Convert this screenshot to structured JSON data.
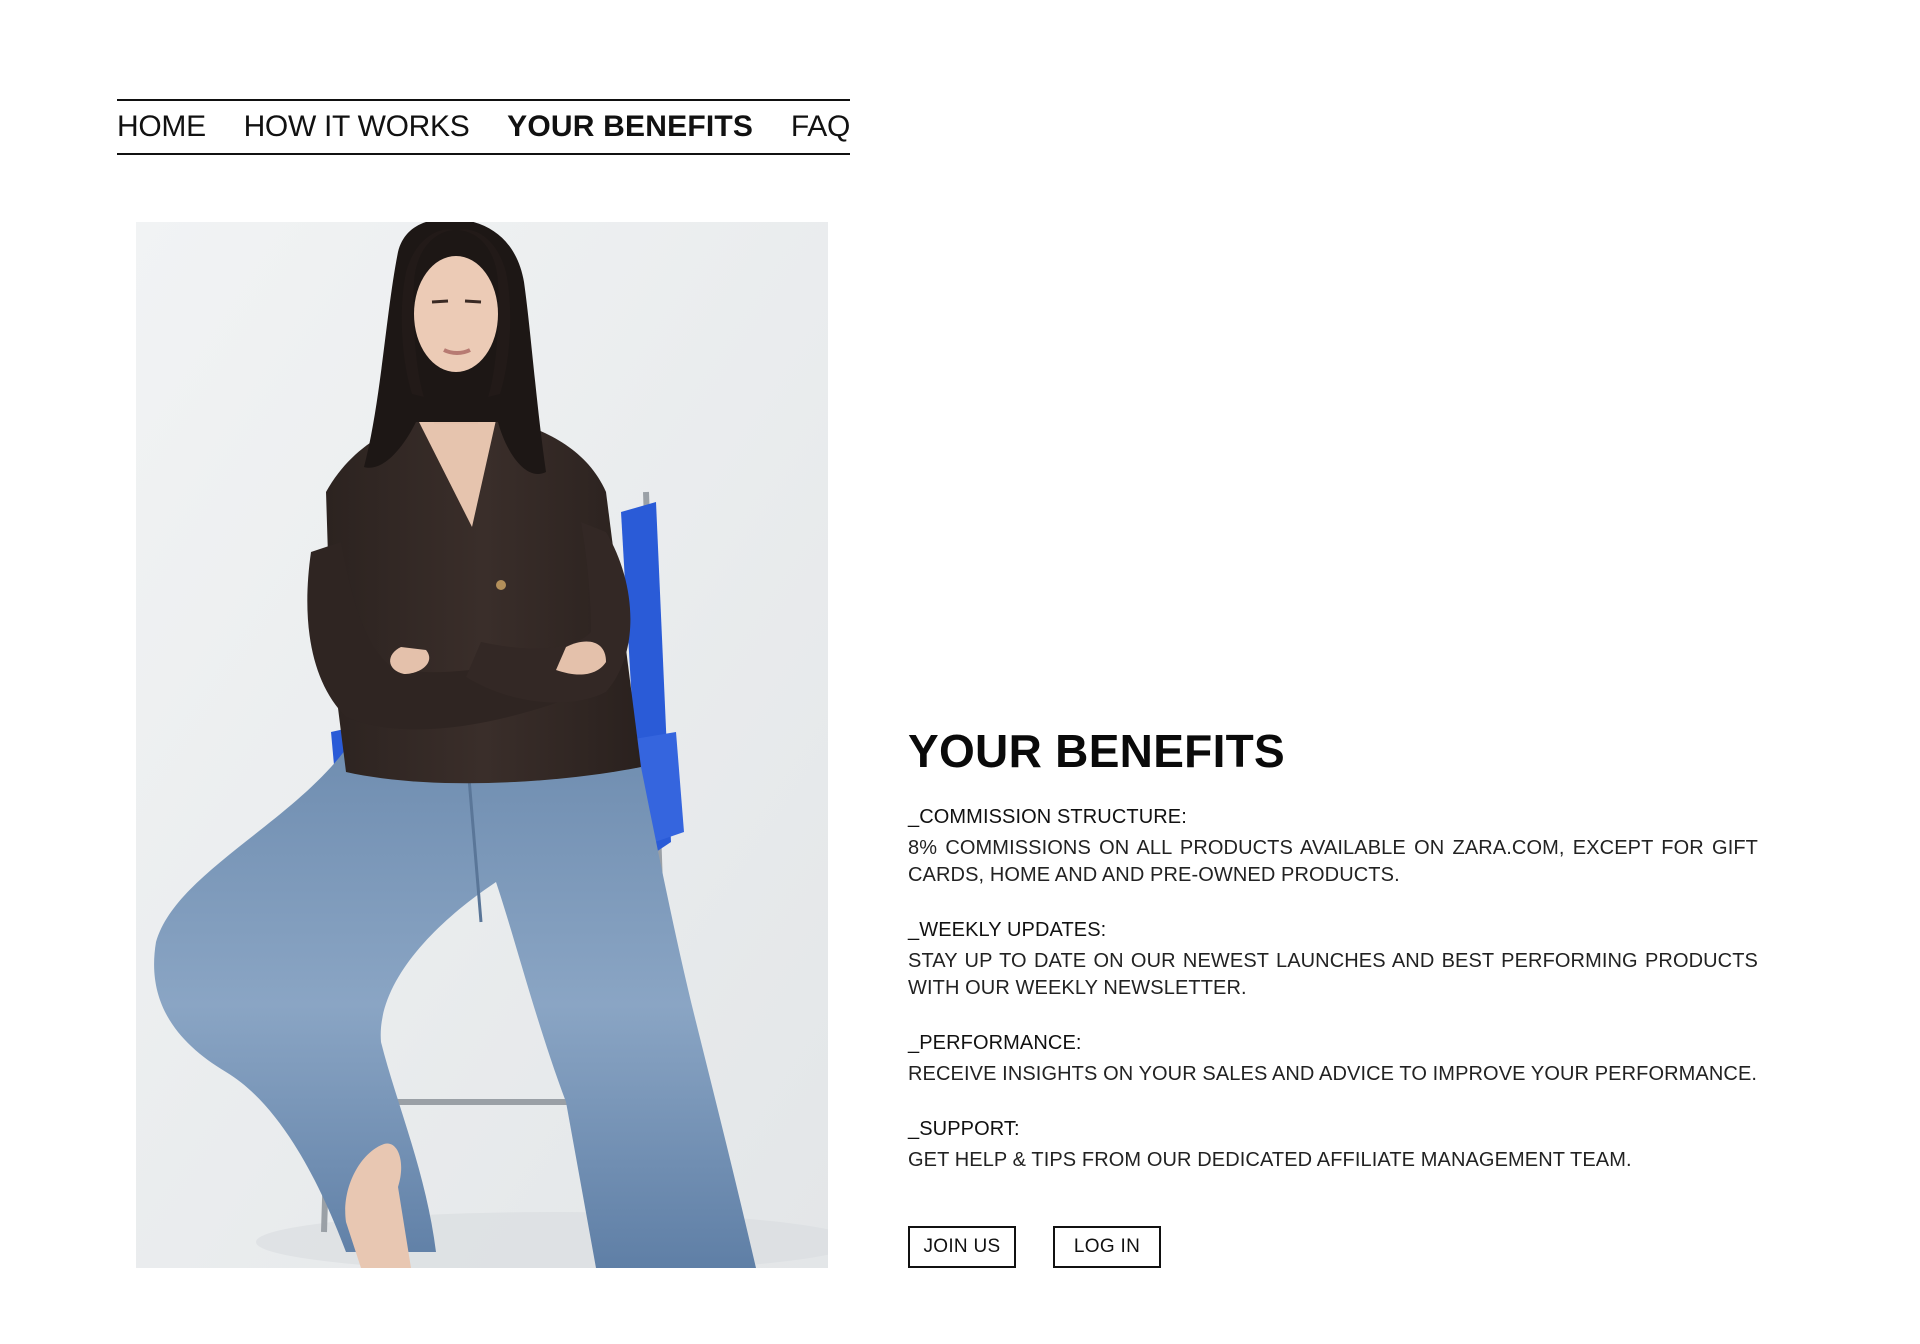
{
  "nav": {
    "items": [
      {
        "label": "HOME",
        "active": false
      },
      {
        "label": "HOW IT WORKS",
        "active": false
      },
      {
        "label": "YOUR BENEFITS",
        "active": true
      },
      {
        "label": "FAQ",
        "active": false
      }
    ]
  },
  "hero_image": {
    "alt": "Model seated on a blue chair wearing a dark brown cardigan and light wash wide-leg jeans"
  },
  "benefits": {
    "heading": "YOUR BENEFITS",
    "items": [
      {
        "title": "_COMMISSION STRUCTURE:",
        "description": "8% COMMISSIONS ON ALL PRODUCTS AVAILABLE ON ZARA.COM, EXCEPT FOR GIFT CARDS, HOME AND AND PRE-OWNED PRODUCTS."
      },
      {
        "title": "_WEEKLY UPDATES:",
        "description": "STAY UP TO DATE ON OUR NEWEST LAUNCHES AND BEST PERFORMING PRODUCTS WITH OUR WEEKLY NEWSLETTER."
      },
      {
        "title": "_PERFORMANCE:",
        "description": "RECEIVE INSIGHTS ON YOUR SALES AND ADVICE TO IMPROVE YOUR PERFORMANCE."
      },
      {
        "title": "_SUPPORT:",
        "description": "GET HELP & TIPS FROM OUR DEDICATED AFFILIATE MANAGEMENT TEAM."
      }
    ]
  },
  "actions": {
    "join_label": "JOIN US",
    "login_label": "LOG IN"
  },
  "colors": {
    "text": "#111111",
    "background": "#ffffff",
    "chair_accent": "#2a5bd7"
  }
}
